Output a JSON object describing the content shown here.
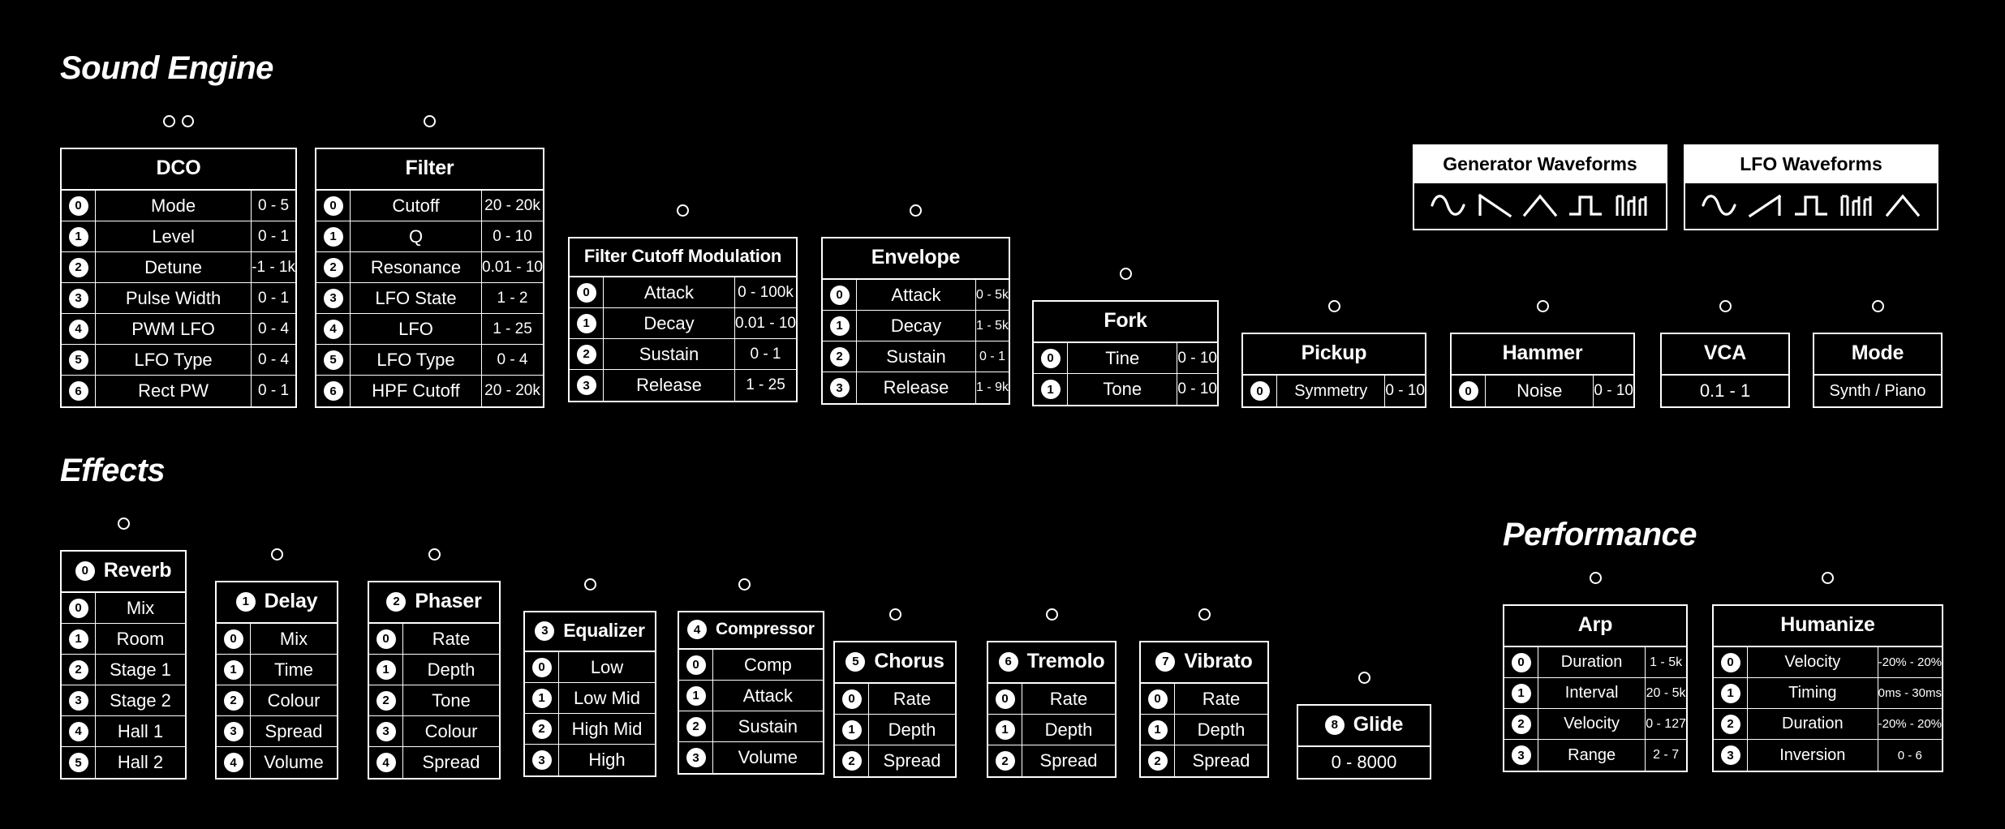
{
  "sections": {
    "sound_engine": "Sound Engine",
    "effects": "Effects",
    "performance": "Performance"
  },
  "colors": {
    "background": "#000000",
    "foreground": "#ffffff"
  },
  "panels": {
    "dco": {
      "title": "DCO",
      "dots": 2,
      "rows": [
        {
          "idx": "0",
          "name": "Mode",
          "range": "0 - 5"
        },
        {
          "idx": "1",
          "name": "Level",
          "range": "0 - 1"
        },
        {
          "idx": "2",
          "name": "Detune",
          "range": "-1 - 1k"
        },
        {
          "idx": "3",
          "name": "Pulse Width",
          "range": "0 - 1"
        },
        {
          "idx": "4",
          "name": "PWM LFO",
          "range": "0 - 4"
        },
        {
          "idx": "5",
          "name": "LFO Type",
          "range": "0 - 4"
        },
        {
          "idx": "6",
          "name": "Rect PW",
          "range": "0 - 1"
        }
      ]
    },
    "filter": {
      "title": "Filter",
      "dots": 1,
      "rows": [
        {
          "idx": "0",
          "name": "Cutoff",
          "range": "20 - 20k"
        },
        {
          "idx": "1",
          "name": "Q",
          "range": "0 - 10"
        },
        {
          "idx": "2",
          "name": "Resonance",
          "range": "0.01 - 10"
        },
        {
          "idx": "3",
          "name": "LFO State",
          "range": "1 - 2"
        },
        {
          "idx": "4",
          "name": "LFO",
          "range": "1 - 25"
        },
        {
          "idx": "5",
          "name": "LFO Type",
          "range": "0 - 4"
        },
        {
          "idx": "6",
          "name": "HPF Cutoff",
          "range": "20 - 20k"
        }
      ]
    },
    "filter_cutoff_modulation": {
      "title": "Filter Cutoff Modulation",
      "dots": 1,
      "rows": [
        {
          "idx": "0",
          "name": "Attack",
          "range": "0 - 100k"
        },
        {
          "idx": "1",
          "name": "Decay",
          "range": "0.01 - 10"
        },
        {
          "idx": "2",
          "name": "Sustain",
          "range": "0 - 1"
        },
        {
          "idx": "3",
          "name": "Release",
          "range": "1 - 25"
        }
      ]
    },
    "envelope": {
      "title": "Envelope",
      "dots": 1,
      "rows": [
        {
          "idx": "0",
          "name": "Attack",
          "range": "0 - 5k"
        },
        {
          "idx": "1",
          "name": "Decay",
          "range": "1 - 5k"
        },
        {
          "idx": "2",
          "name": "Sustain",
          "range": "0 - 1"
        },
        {
          "idx": "3",
          "name": "Release",
          "range": "1 - 9k"
        }
      ]
    },
    "fork": {
      "title": "Fork",
      "dots": 1,
      "rows": [
        {
          "idx": "0",
          "name": "Tine",
          "range": "0 - 10"
        },
        {
          "idx": "1",
          "name": "Tone",
          "range": "0 - 10"
        }
      ]
    },
    "pickup": {
      "title": "Pickup",
      "dots": 1,
      "rows": [
        {
          "idx": "0",
          "name": "Symmetry",
          "range": "0 - 10"
        }
      ]
    },
    "hammer": {
      "title": "Hammer",
      "dots": 1,
      "rows": [
        {
          "idx": "0",
          "name": "Noise",
          "range": "0 - 10"
        }
      ]
    },
    "vca": {
      "title": "VCA",
      "dots": 1,
      "value": "0.1 - 1"
    },
    "mode": {
      "title": "Mode",
      "dots": 1,
      "value": "Synth / Piano"
    },
    "reverb": {
      "title": "Reverb",
      "badge": "0",
      "dots": 1,
      "rows": [
        {
          "idx": "0",
          "name": "Mix"
        },
        {
          "idx": "1",
          "name": "Room"
        },
        {
          "idx": "2",
          "name": "Stage 1"
        },
        {
          "idx": "3",
          "name": "Stage 2"
        },
        {
          "idx": "4",
          "name": "Hall 1"
        },
        {
          "idx": "5",
          "name": "Hall 2"
        }
      ]
    },
    "delay": {
      "title": "Delay",
      "badge": "1",
      "dots": 1,
      "rows": [
        {
          "idx": "0",
          "name": "Mix"
        },
        {
          "idx": "1",
          "name": "Time"
        },
        {
          "idx": "2",
          "name": "Colour"
        },
        {
          "idx": "3",
          "name": "Spread"
        },
        {
          "idx": "4",
          "name": "Volume"
        }
      ]
    },
    "phaser": {
      "title": "Phaser",
      "badge": "2",
      "dots": 1,
      "rows": [
        {
          "idx": "0",
          "name": "Rate"
        },
        {
          "idx": "1",
          "name": "Depth"
        },
        {
          "idx": "2",
          "name": "Tone"
        },
        {
          "idx": "3",
          "name": "Colour"
        },
        {
          "idx": "4",
          "name": "Spread"
        }
      ]
    },
    "equalizer": {
      "title": "Equalizer",
      "badge": "3",
      "dots": 1,
      "rows": [
        {
          "idx": "0",
          "name": "Low"
        },
        {
          "idx": "1",
          "name": "Low Mid"
        },
        {
          "idx": "2",
          "name": "High Mid"
        },
        {
          "idx": "3",
          "name": "High"
        }
      ]
    },
    "compressor": {
      "title": "Compressor",
      "badge": "4",
      "dots": 1,
      "rows": [
        {
          "idx": "0",
          "name": "Comp"
        },
        {
          "idx": "1",
          "name": "Attack"
        },
        {
          "idx": "2",
          "name": "Sustain"
        },
        {
          "idx": "3",
          "name": "Volume"
        }
      ]
    },
    "chorus": {
      "title": "Chorus",
      "badge": "5",
      "dots": 1,
      "rows": [
        {
          "idx": "0",
          "name": "Rate"
        },
        {
          "idx": "1",
          "name": "Depth"
        },
        {
          "idx": "2",
          "name": "Spread"
        }
      ]
    },
    "tremolo": {
      "title": "Tremolo",
      "badge": "6",
      "dots": 1,
      "rows": [
        {
          "idx": "0",
          "name": "Rate"
        },
        {
          "idx": "1",
          "name": "Depth"
        },
        {
          "idx": "2",
          "name": "Spread"
        }
      ]
    },
    "vibrato": {
      "title": "Vibrato",
      "badge": "7",
      "dots": 1,
      "rows": [
        {
          "idx": "0",
          "name": "Rate"
        },
        {
          "idx": "1",
          "name": "Depth"
        },
        {
          "idx": "2",
          "name": "Spread"
        }
      ]
    },
    "glide": {
      "title": "Glide",
      "badge": "8",
      "dots": 1,
      "value": "0 - 8000"
    },
    "arp": {
      "title": "Arp",
      "dots": 1,
      "rows": [
        {
          "idx": "0",
          "name": "Duration",
          "range": "1 - 5k"
        },
        {
          "idx": "1",
          "name": "Interval",
          "range": "20 - 5k"
        },
        {
          "idx": "2",
          "name": "Velocity",
          "range": "0 - 127"
        },
        {
          "idx": "3",
          "name": "Range",
          "range": "2 - 7"
        }
      ]
    },
    "humanize": {
      "title": "Humanize",
      "dots": 1,
      "rows": [
        {
          "idx": "0",
          "name": "Velocity",
          "range": "-20% - 20%"
        },
        {
          "idx": "1",
          "name": "Timing",
          "range": "0ms - 30ms"
        },
        {
          "idx": "2",
          "name": "Duration",
          "range": "-20% - 20%"
        },
        {
          "idx": "3",
          "name": "Inversion",
          "range": "0 - 6"
        }
      ]
    }
  },
  "waveform_panels": {
    "generator": {
      "title": "Generator Waveforms",
      "waveforms": [
        "sine",
        "saw-down",
        "triangle",
        "square",
        "noise"
      ]
    },
    "lfo": {
      "title": "LFO Waveforms",
      "waveforms": [
        "sine",
        "saw-up",
        "square",
        "noise",
        "triangle"
      ]
    }
  }
}
